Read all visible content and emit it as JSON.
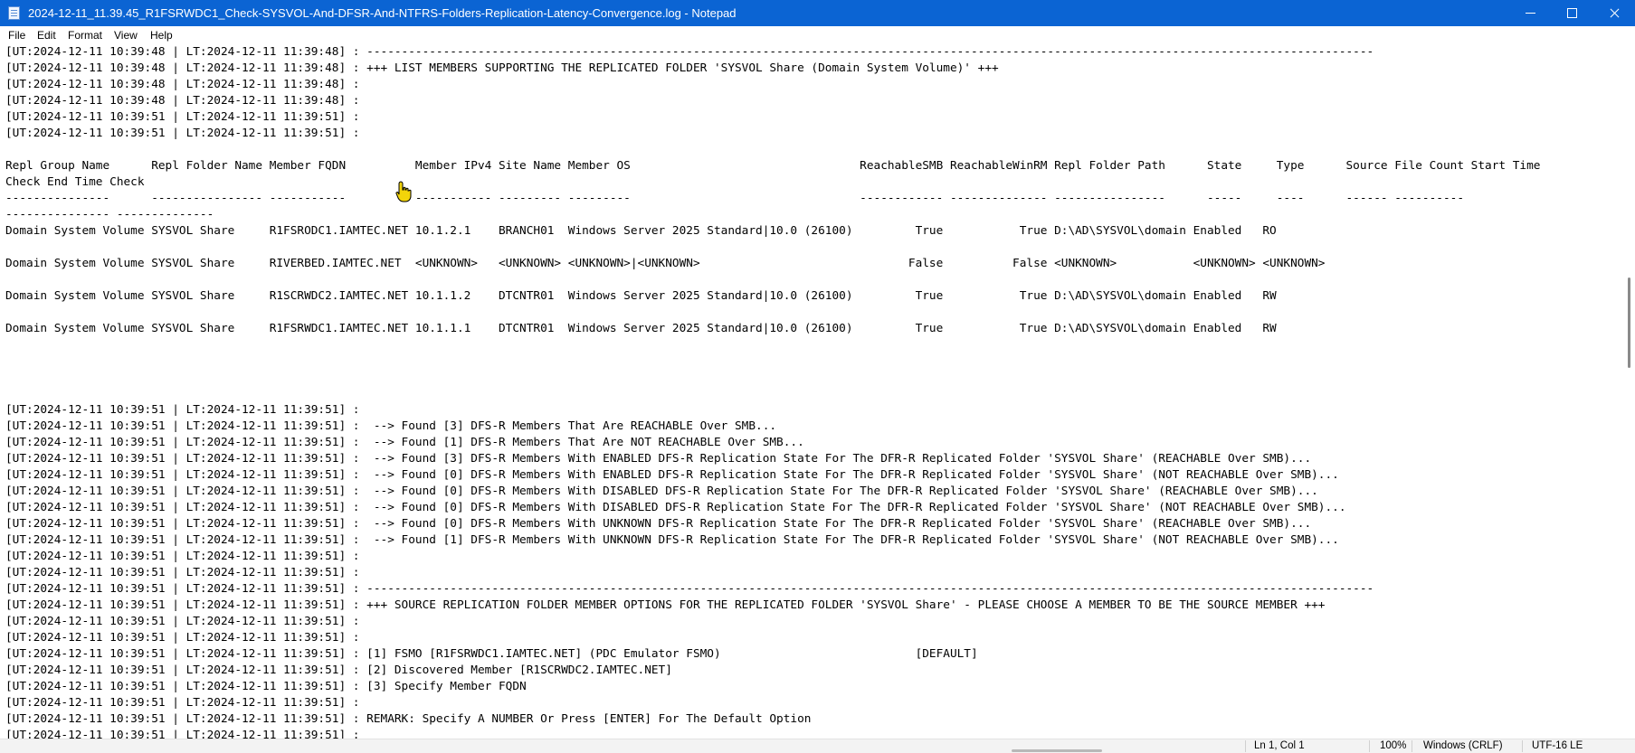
{
  "window": {
    "title": "2024-12-11_11.39.45_R1FSRWDC1_Check-SYSVOL-And-DFSR-And-NTFRS-Folders-Replication-Latency-Convergence.log - Notepad"
  },
  "menu": {
    "file": "File",
    "edit": "Edit",
    "format": "Format",
    "view": "View",
    "help": "Help"
  },
  "lines": [
    "[UT:2024-12-11 10:39:48 | LT:2024-12-11 11:39:48] : -------------------------------------------------------------------------------------------------------------------------------------------------",
    "[UT:2024-12-11 10:39:48 | LT:2024-12-11 11:39:48] : +++ LIST MEMBERS SUPPORTING THE REPLICATED FOLDER 'SYSVOL Share (Domain System Volume)' +++",
    "[UT:2024-12-11 10:39:48 | LT:2024-12-11 11:39:48] :",
    "[UT:2024-12-11 10:39:48 | LT:2024-12-11 11:39:48] :",
    "[UT:2024-12-11 10:39:51 | LT:2024-12-11 11:39:51] :",
    "[UT:2024-12-11 10:39:51 | LT:2024-12-11 11:39:51] :",
    "",
    "Repl Group Name      Repl Folder Name Member FQDN          Member IPv4 Site Name Member OS                                 ReachableSMB ReachableWinRM Repl Folder Path      State     Type      Source File Count Start Time",
    "Check End Time Check",
    "---------------      ---------------- -----------          ----------- --------- ---------                                 ------------ -------------- ----------------      -----     ----      ------ ----------",
    "--------------- --------------",
    "Domain System Volume SYSVOL Share     R1FSRODC1.IAMTEC.NET 10.1.2.1    BRANCH01  Windows Server 2025 Standard|10.0 (26100)         True           True D:\\AD\\SYSVOL\\domain Enabled   RO",
    "",
    "Domain System Volume SYSVOL Share     RIVERBED.IAMTEC.NET  <UNKNOWN>   <UNKNOWN> <UNKNOWN>|<UNKNOWN>                              False          False <UNKNOWN>           <UNKNOWN> <UNKNOWN>",
    "",
    "Domain System Volume SYSVOL Share     R1SCRWDC2.IAMTEC.NET 10.1.1.2    DTCNTR01  Windows Server 2025 Standard|10.0 (26100)         True           True D:\\AD\\SYSVOL\\domain Enabled   RW",
    "",
    "Domain System Volume SYSVOL Share     R1FSRWDC1.IAMTEC.NET 10.1.1.1    DTCNTR01  Windows Server 2025 Standard|10.0 (26100)         True           True D:\\AD\\SYSVOL\\domain Enabled   RW",
    "",
    "",
    "",
    "",
    "[UT:2024-12-11 10:39:51 | LT:2024-12-11 11:39:51] :",
    "[UT:2024-12-11 10:39:51 | LT:2024-12-11 11:39:51] :  --> Found [3] DFS-R Members That Are REACHABLE Over SMB...",
    "[UT:2024-12-11 10:39:51 | LT:2024-12-11 11:39:51] :  --> Found [1] DFS-R Members That Are NOT REACHABLE Over SMB...",
    "[UT:2024-12-11 10:39:51 | LT:2024-12-11 11:39:51] :  --> Found [3] DFS-R Members With ENABLED DFS-R Replication State For The DFR-R Replicated Folder 'SYSVOL Share' (REACHABLE Over SMB)...",
    "[UT:2024-12-11 10:39:51 | LT:2024-12-11 11:39:51] :  --> Found [0] DFS-R Members With ENABLED DFS-R Replication State For The DFR-R Replicated Folder 'SYSVOL Share' (NOT REACHABLE Over SMB)...",
    "[UT:2024-12-11 10:39:51 | LT:2024-12-11 11:39:51] :  --> Found [0] DFS-R Members With DISABLED DFS-R Replication State For The DFR-R Replicated Folder 'SYSVOL Share' (REACHABLE Over SMB)...",
    "[UT:2024-12-11 10:39:51 | LT:2024-12-11 11:39:51] :  --> Found [0] DFS-R Members With DISABLED DFS-R Replication State For The DFR-R Replicated Folder 'SYSVOL Share' (NOT REACHABLE Over SMB)...",
    "[UT:2024-12-11 10:39:51 | LT:2024-12-11 11:39:51] :  --> Found [0] DFS-R Members With UNKNOWN DFS-R Replication State For The DFR-R Replicated Folder 'SYSVOL Share' (REACHABLE Over SMB)...",
    "[UT:2024-12-11 10:39:51 | LT:2024-12-11 11:39:51] :  --> Found [1] DFS-R Members With UNKNOWN DFS-R Replication State For The DFR-R Replicated Folder 'SYSVOL Share' (NOT REACHABLE Over SMB)...",
    "[UT:2024-12-11 10:39:51 | LT:2024-12-11 11:39:51] :",
    "[UT:2024-12-11 10:39:51 | LT:2024-12-11 11:39:51] :",
    "[UT:2024-12-11 10:39:51 | LT:2024-12-11 11:39:51] : -------------------------------------------------------------------------------------------------------------------------------------------------",
    "[UT:2024-12-11 10:39:51 | LT:2024-12-11 11:39:51] : +++ SOURCE REPLICATION FOLDER MEMBER OPTIONS FOR THE REPLICATED FOLDER 'SYSVOL Share' - PLEASE CHOOSE A MEMBER TO BE THE SOURCE MEMBER +++",
    "[UT:2024-12-11 10:39:51 | LT:2024-12-11 11:39:51] :",
    "[UT:2024-12-11 10:39:51 | LT:2024-12-11 11:39:51] :",
    "[UT:2024-12-11 10:39:51 | LT:2024-12-11 11:39:51] : [1] FSMO [R1FSRWDC1.IAMTEC.NET] (PDC Emulator FSMO)                            [DEFAULT]",
    "[UT:2024-12-11 10:39:51 | LT:2024-12-11 11:39:51] : [2] Discovered Member [R1SCRWDC2.IAMTEC.NET]",
    "[UT:2024-12-11 10:39:51 | LT:2024-12-11 11:39:51] : [3] Specify Member FQDN",
    "[UT:2024-12-11 10:39:51 | LT:2024-12-11 11:39:51] :",
    "[UT:2024-12-11 10:39:51 | LT:2024-12-11 11:39:51] : REMARK: Specify A NUMBER Or Press [ENTER] For The Default Option",
    "[UT:2024-12-11 10:39:51 | LT:2024-12-11 11:39:51] :",
    "[UT:2024-12-11 10:39:51 | LT:2024-12-11 11:39:51] :"
  ],
  "status": {
    "position": "Ln 1, Col 1",
    "zoom": "100%",
    "line_ending": "Windows (CRLF)",
    "encoding": "UTF-16 LE"
  },
  "icons": {
    "app": "notepad-icon",
    "minimize": "minimize-icon",
    "maximize": "maximize-icon",
    "close": "close-icon",
    "cursor": "hand-pointer-icon"
  }
}
